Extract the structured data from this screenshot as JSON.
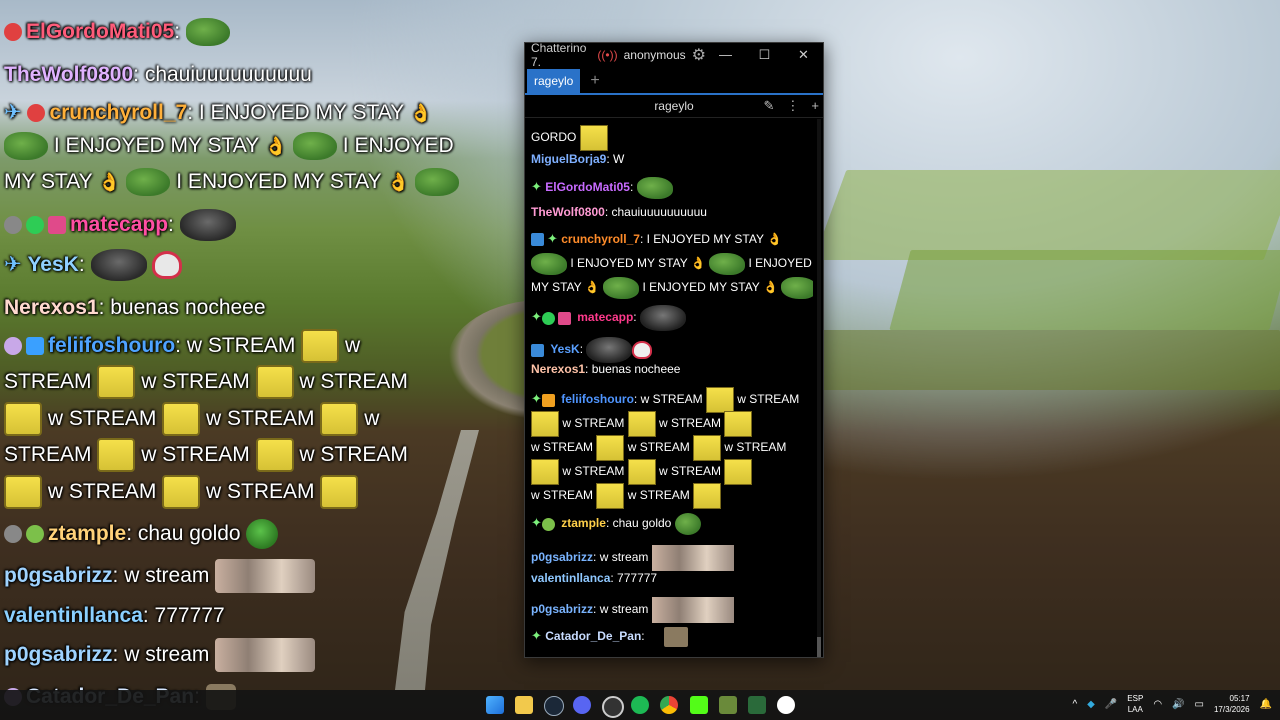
{
  "overlay": {
    "lines": [
      {
        "user": "ElGordoMati05",
        "text": ":"
      },
      {
        "user": "TheWolf0800",
        "text": ": chauiuuuuuuuuuu"
      },
      {
        "user": "crunchyroll_7",
        "text": ": I ENJOYED MY STAY"
      },
      {
        "text": "I ENJOYED MY STAY",
        "text2": "I ENJOYED"
      },
      {
        "text": "MY STAY",
        "text2": "I ENJOYED MY STAY"
      },
      {
        "user": "matecapp",
        "text": ":"
      },
      {
        "user": "YesK",
        "text": ":"
      },
      {
        "user": "Nerexos1",
        "text": ": buenas nocheee"
      },
      {
        "user": "feliifoshouro",
        "text": ": w STREAM",
        "tail": "w"
      },
      {
        "segments": [
          "STREAM",
          "w STREAM",
          "w STREAM"
        ]
      },
      {
        "segments": [
          "w STREAM",
          "w STREAM",
          "w"
        ]
      },
      {
        "segments": [
          "STREAM",
          "w STREAM",
          "w STREAM"
        ]
      },
      {
        "segments": [
          "w STREAM",
          "w STREAM"
        ]
      },
      {
        "user": "ztample",
        "text": ": chau goldo"
      },
      {
        "user": "p0gsabrizz",
        "text": ": w stream"
      },
      {
        "user": "valentinllanca",
        "text": ": 777777"
      },
      {
        "user": "p0gsabrizz",
        "text": ": w stream"
      },
      {
        "user": "Catador_De_Pan",
        "text": ":"
      }
    ]
  },
  "window": {
    "title": "Chatterino 7.",
    "account": "anonymous",
    "tab": "rageylo",
    "split_channel": "rageylo"
  },
  "chat": {
    "top_partial": "GORDO",
    "messages": [
      {
        "user": "MiguelBorja9",
        "text": "W"
      },
      {
        "user": "ElGordoMati05",
        "text": ""
      },
      {
        "user": "TheWolf0800",
        "text": "chauiuuuuuuuuuu"
      },
      {
        "user": "crunchyroll_7",
        "text": "I ENJOYED MY STAY"
      },
      {
        "text": "I ENJOYED MY STAY",
        "text2": "I ENJOYED"
      },
      {
        "text": "MY STAY",
        "text2": "I ENJOYED MY STAY"
      },
      {
        "user": "matecapp",
        "text": ""
      },
      {
        "user": "YesK",
        "text": ""
      },
      {
        "user": "Nerexos1",
        "text": "buenas nocheee"
      },
      {
        "user": "feliifoshouro",
        "text": "w STREAM",
        "text2": "w STREAM"
      },
      {
        "segments": [
          "w STREAM",
          "w STREAM"
        ]
      },
      {
        "segments": [
          "w STREAM",
          "w STREAM",
          "w STREAM"
        ]
      },
      {
        "segments": [
          "w STREAM",
          "w STREAM"
        ]
      },
      {
        "segments": [
          "w STREAM",
          "w STREAM"
        ]
      },
      {
        "user": "ztample",
        "text": "chau goldo"
      },
      {
        "user": "p0gsabrizz",
        "text": "w stream"
      },
      {
        "user": "valentinllanca",
        "text": "777777"
      },
      {
        "user": "p0gsabrizz",
        "text": "w stream"
      },
      {
        "user": "Catador_De_Pan",
        "text": ""
      }
    ]
  },
  "taskbar": {
    "lang_top": "ESP",
    "lang_bottom": "LAA",
    "time": "05:17",
    "date": "17/3/2026"
  },
  "colors": {
    "tab_accent": "#2a72c8",
    "taskbar_bg": "#141414"
  }
}
